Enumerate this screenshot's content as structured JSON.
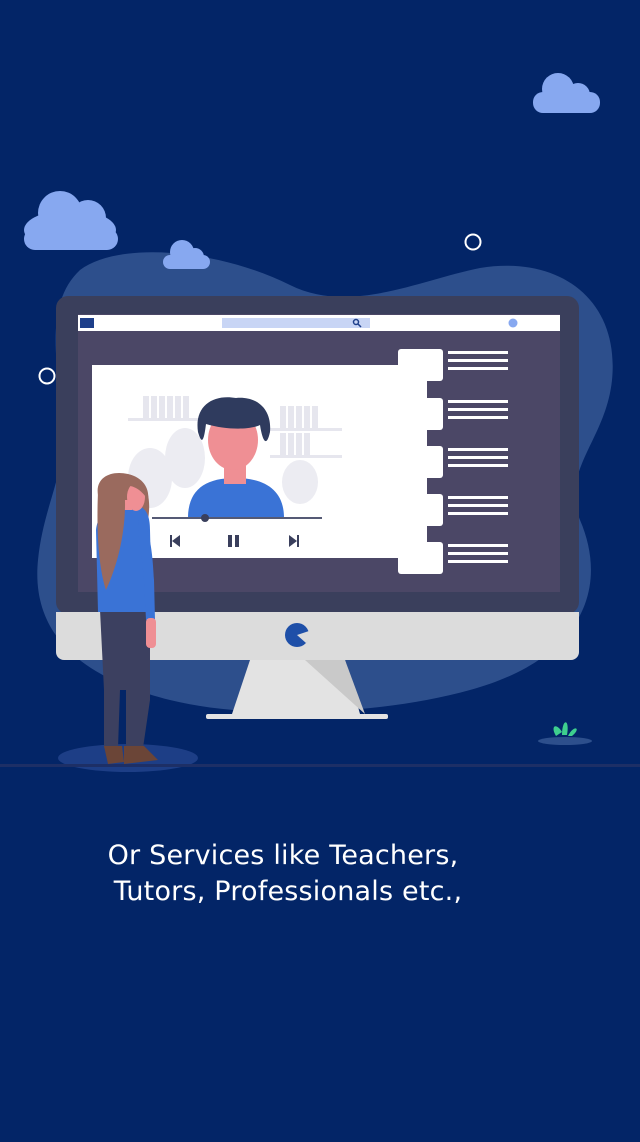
{
  "caption": {
    "line1": "Or Services like Teachers,",
    "line2": "Tutors, Professionals etc.,"
  },
  "colors": {
    "background": "#032567",
    "blob": "#2d4f8c",
    "monitor_frame": "#3a3f5c",
    "screen_bg": "#4b4766",
    "video_panel": "#ffffff",
    "cloud": "#87a8f0",
    "accent": "#1e4fa8",
    "plant": "#3ecf8e"
  },
  "icons": {
    "prev": "skip-back-icon",
    "pause": "pause-icon",
    "next": "skip-forward-icon",
    "search": "search-icon",
    "logo": "pie-logo-icon"
  }
}
